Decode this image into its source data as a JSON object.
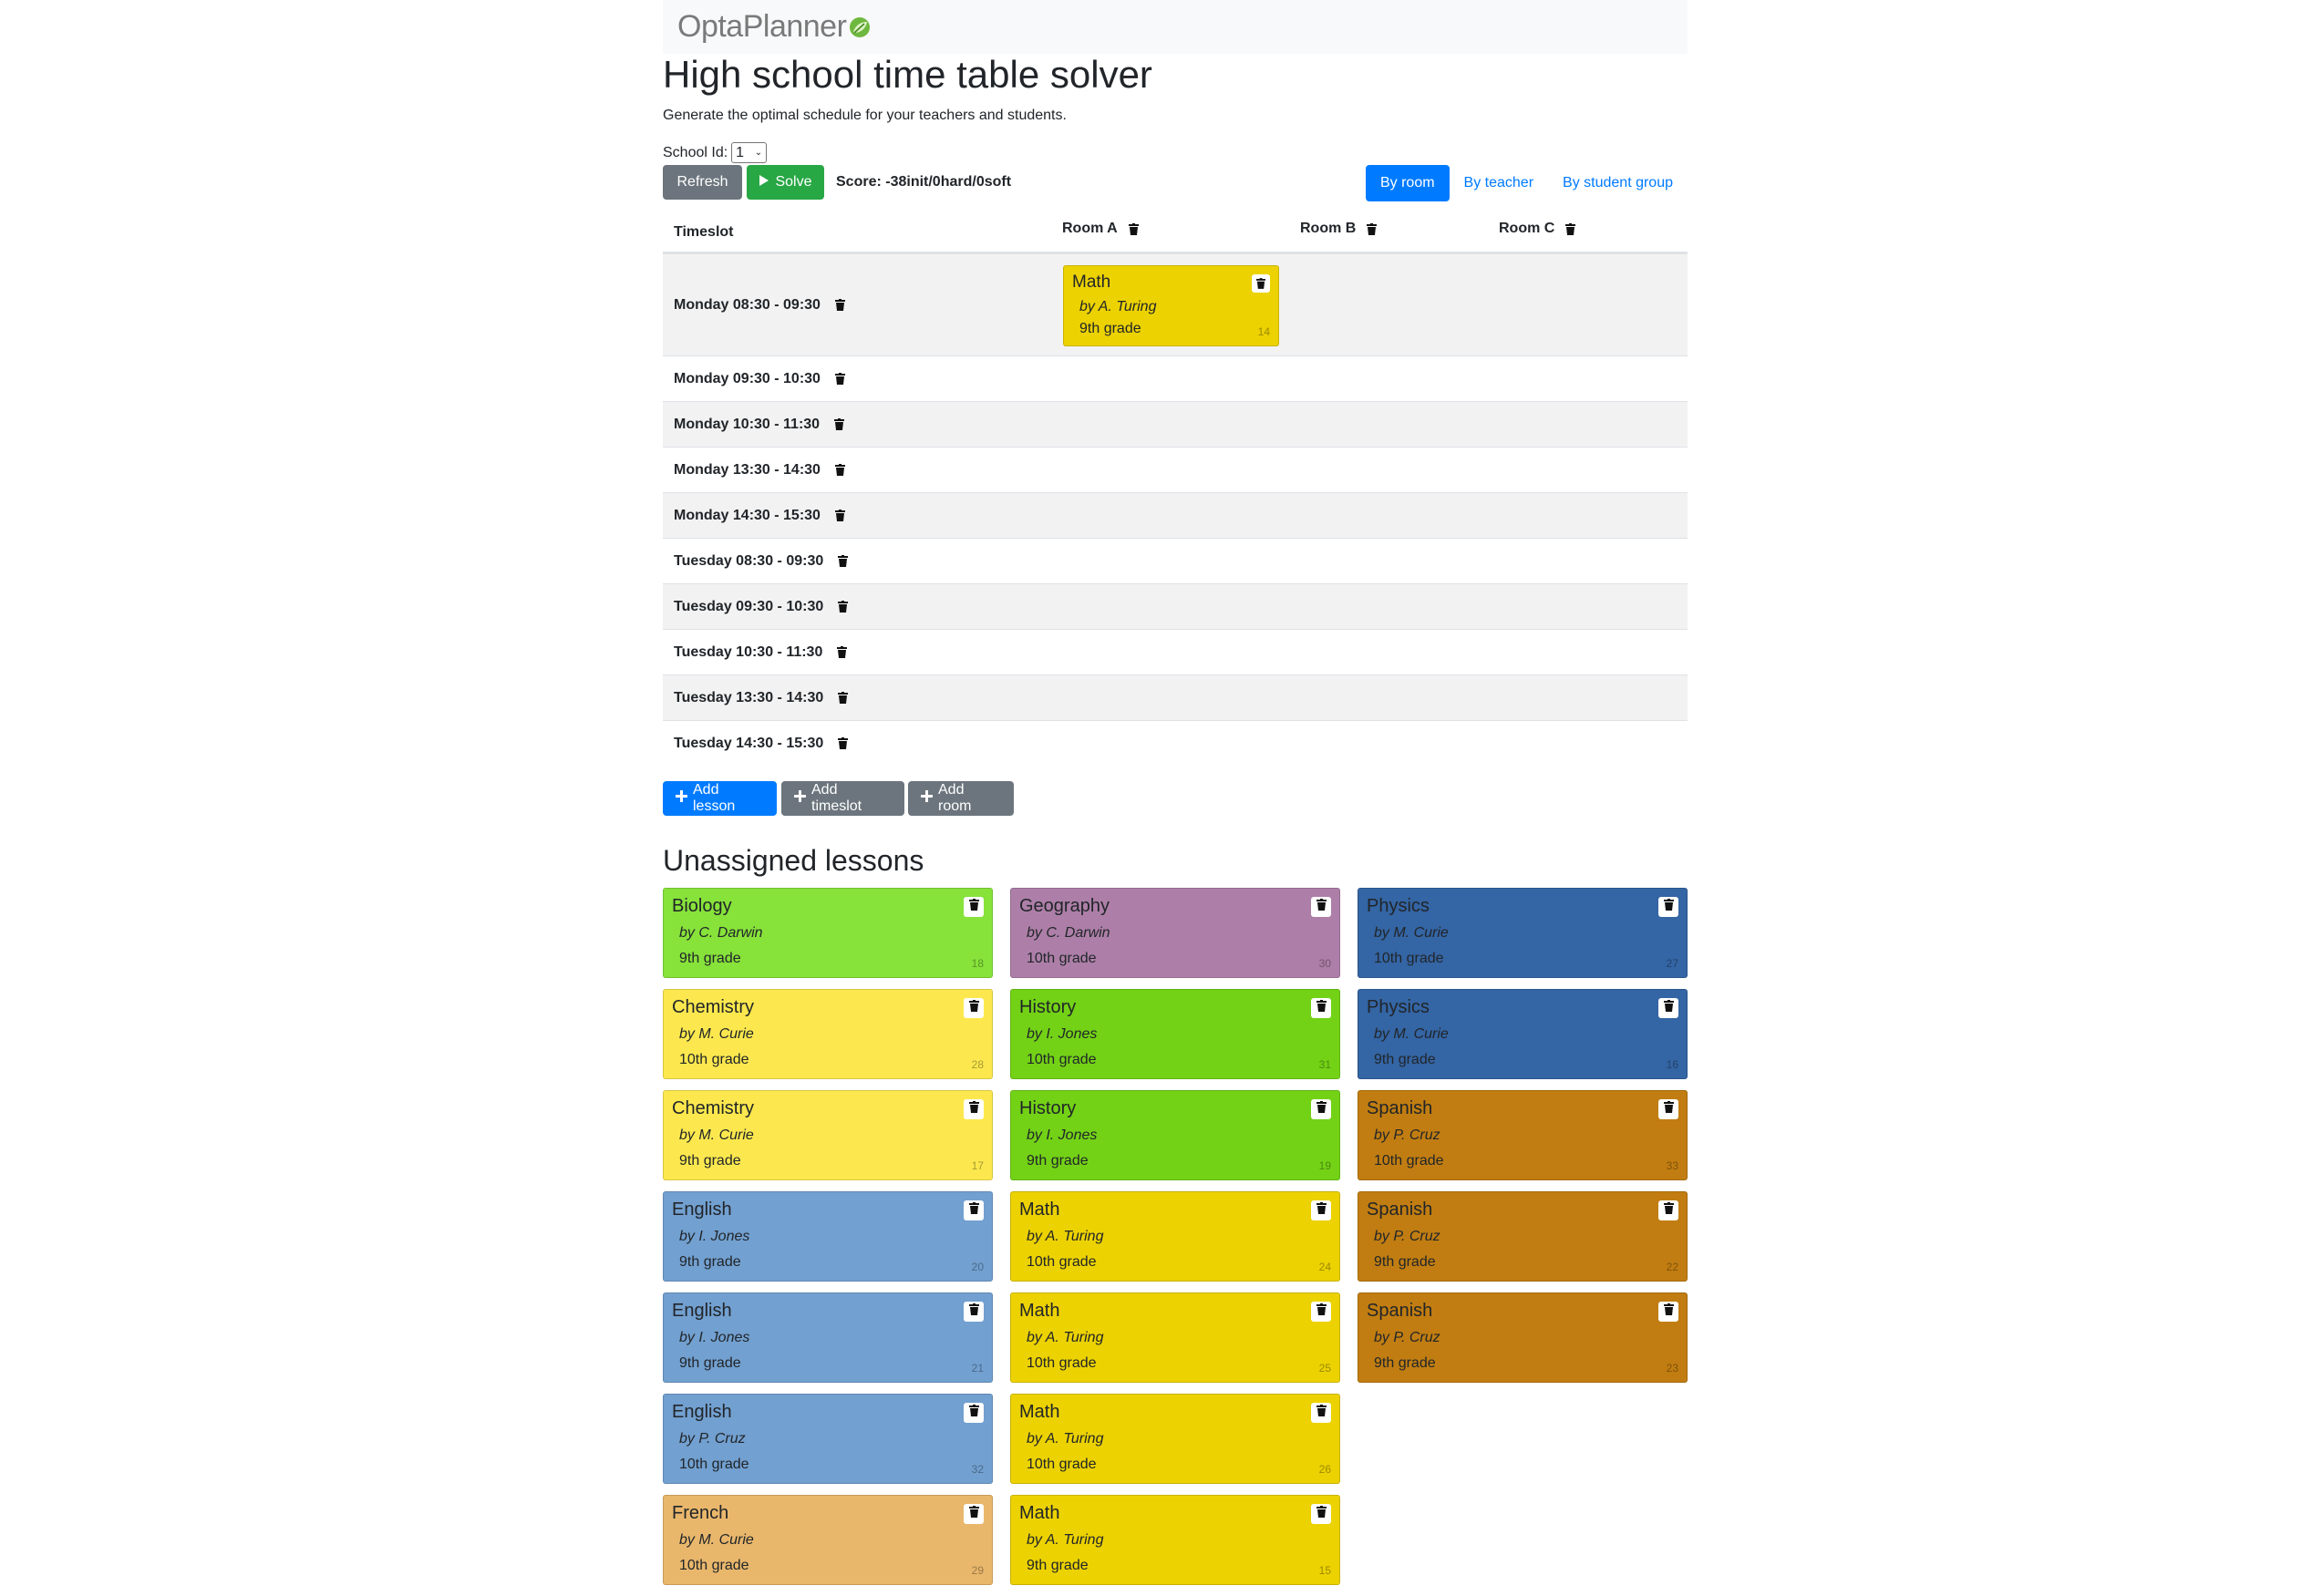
{
  "brand": {
    "name": "OptaPlanner"
  },
  "page": {
    "title": "High school time table solver",
    "subtitle": "Generate the optimal schedule for your teachers and students."
  },
  "school": {
    "label": "School Id:",
    "value": "1"
  },
  "toolbar": {
    "refresh_label": "Refresh",
    "solve_label": "Solve",
    "score_label": "Score: -38init/0hard/0soft",
    "tabs": [
      "By room",
      "By teacher",
      "By student group"
    ]
  },
  "timetable": {
    "timeslot_header": "Timeslot",
    "rooms": [
      "Room A",
      "Room B",
      "Room C"
    ],
    "timeslots": [
      "Monday 08:30 - 09:30",
      "Monday 09:30 - 10:30",
      "Monday 10:30 - 11:30",
      "Monday 13:30 - 14:30",
      "Monday 14:30 - 15:30",
      "Tuesday 08:30 - 09:30",
      "Tuesday 09:30 - 10:30",
      "Tuesday 10:30 - 11:30",
      "Tuesday 13:30 - 14:30",
      "Tuesday 14:30 - 15:30"
    ],
    "assigned_lesson": {
      "subject": "Math",
      "teacher": "by A. Turing",
      "group": "9th grade",
      "id": "14",
      "color": "#ecd200"
    }
  },
  "actions": {
    "add_lesson": "Add lesson",
    "add_timeslot": "Add timeslot",
    "add_room": "Add room"
  },
  "unassigned": {
    "title": "Unassigned lessons",
    "columns": [
      [
        {
          "subject": "Biology",
          "teacher": "by C. Darwin",
          "group": "9th grade",
          "id": "18",
          "color": "#87e23a"
        },
        {
          "subject": "Chemistry",
          "teacher": "by M. Curie",
          "group": "10th grade",
          "id": "28",
          "color": "#fce84e"
        },
        {
          "subject": "Chemistry",
          "teacher": "by M. Curie",
          "group": "9th grade",
          "id": "17",
          "color": "#fce84e"
        },
        {
          "subject": "English",
          "teacher": "by I. Jones",
          "group": "9th grade",
          "id": "20",
          "color": "#72a0d0"
        },
        {
          "subject": "English",
          "teacher": "by I. Jones",
          "group": "9th grade",
          "id": "21",
          "color": "#72a0d0"
        },
        {
          "subject": "English",
          "teacher": "by P. Cruz",
          "group": "10th grade",
          "id": "32",
          "color": "#72a0d0"
        },
        {
          "subject": "French",
          "teacher": "by M. Curie",
          "group": "10th grade",
          "id": "29",
          "color": "#e9b76c"
        }
      ],
      [
        {
          "subject": "Geography",
          "teacher": "by C. Darwin",
          "group": "10th grade",
          "id": "30",
          "color": "#ad7fa8"
        },
        {
          "subject": "History",
          "teacher": "by I. Jones",
          "group": "10th grade",
          "id": "31",
          "color": "#73d216"
        },
        {
          "subject": "History",
          "teacher": "by I. Jones",
          "group": "9th grade",
          "id": "19",
          "color": "#73d216"
        },
        {
          "subject": "Math",
          "teacher": "by A. Turing",
          "group": "10th grade",
          "id": "24",
          "color": "#ecd200"
        },
        {
          "subject": "Math",
          "teacher": "by A. Turing",
          "group": "10th grade",
          "id": "25",
          "color": "#ecd200"
        },
        {
          "subject": "Math",
          "teacher": "by A. Turing",
          "group": "10th grade",
          "id": "26",
          "color": "#ecd200"
        },
        {
          "subject": "Math",
          "teacher": "by A. Turing",
          "group": "9th grade",
          "id": "15",
          "color": "#ecd200"
        }
      ],
      [
        {
          "subject": "Physics",
          "teacher": "by M. Curie",
          "group": "10th grade",
          "id": "27",
          "color": "#3465a4"
        },
        {
          "subject": "Physics",
          "teacher": "by M. Curie",
          "group": "9th grade",
          "id": "16",
          "color": "#3465a4"
        },
        {
          "subject": "Spanish",
          "teacher": "by P. Cruz",
          "group": "10th grade",
          "id": "33",
          "color": "#c17d11"
        },
        {
          "subject": "Spanish",
          "teacher": "by P. Cruz",
          "group": "9th grade",
          "id": "22",
          "color": "#c17d11"
        },
        {
          "subject": "Spanish",
          "teacher": "by P. Cruz",
          "group": "9th grade",
          "id": "23",
          "color": "#c17d11"
        }
      ]
    ]
  }
}
